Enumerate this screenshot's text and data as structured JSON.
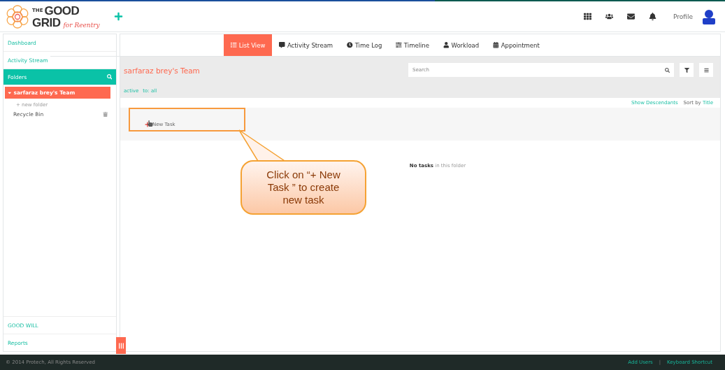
{
  "logo": {
    "the": "THE",
    "good": "GOOD",
    "grid": "GRID",
    "tagline": "for Reentry"
  },
  "header": {
    "profile": "Profile"
  },
  "sidebar": {
    "items": [
      {
        "label": "Dashboard",
        "kind": "link"
      },
      {
        "label": "Activity Stream",
        "kind": "link"
      },
      {
        "label": "Folders",
        "kind": "section"
      }
    ],
    "folders": [
      {
        "label": "sarfaraz brey's Team",
        "selected": true,
        "expanded": true
      }
    ],
    "new_folder": "+ new folder",
    "recycle_bin": "Recycle Bin",
    "bottom_items": [
      "GOOD WILL",
      "Reports"
    ]
  },
  "tabs": [
    {
      "label": "List View",
      "selected": true
    },
    {
      "label": "Activity Stream",
      "selected": false
    },
    {
      "label": "Time Log",
      "selected": false
    },
    {
      "label": "Timeline",
      "selected": false
    },
    {
      "label": "Workload",
      "selected": false
    },
    {
      "label": "Appointment",
      "selected": false
    }
  ],
  "folder_title": "sarfaraz brey's Team",
  "filters": [
    "active",
    "to: all"
  ],
  "search": {
    "placeholder": "Search"
  },
  "show_descendants": "Show Descendants",
  "sort_label": "Sort by",
  "sort_value": "Title",
  "new_task": "New Task",
  "empty_bold": "No tasks",
  "empty_rest": "in this folder",
  "callout": "Click on “+ New Task ” to create new task",
  "footer": {
    "copyright": "© 2014 Protech, All Rights Reserved",
    "links": [
      "Add Users",
      "Keyboard Shortcut"
    ],
    "separator": "|"
  }
}
